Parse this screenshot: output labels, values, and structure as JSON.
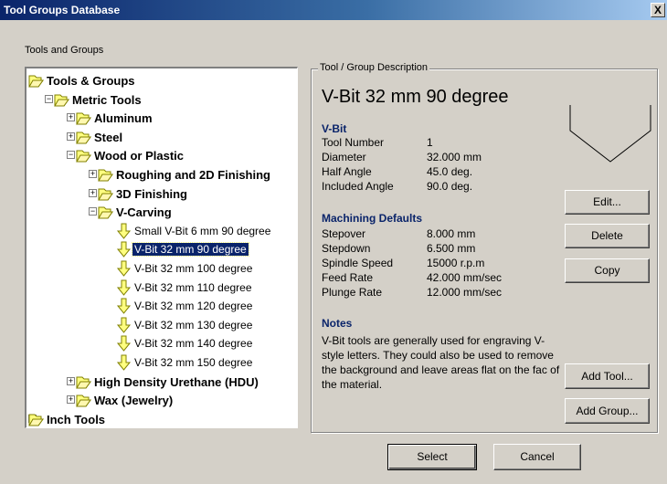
{
  "window": {
    "title": "Tool Groups Database",
    "close_label": "X"
  },
  "tree_label": "Tools and Groups",
  "tree": [
    {
      "label": "Tools & Groups",
      "level": 0,
      "toggle": "",
      "bold": true,
      "type": "folder"
    },
    {
      "label": "Metric Tools",
      "level": 1,
      "toggle": "-",
      "bold": true,
      "type": "folder"
    },
    {
      "label": "Aluminum",
      "level": 2,
      "toggle": "+",
      "bold": true,
      "type": "folder"
    },
    {
      "label": "Steel",
      "level": 2,
      "toggle": "+",
      "bold": true,
      "type": "folder"
    },
    {
      "label": "Wood or Plastic",
      "level": 2,
      "toggle": "-",
      "bold": true,
      "type": "folder"
    },
    {
      "label": "Roughing and 2D Finishing",
      "level": 3,
      "toggle": "+",
      "bold": true,
      "type": "folder"
    },
    {
      "label": "3D Finishing",
      "level": 3,
      "toggle": "+",
      "bold": true,
      "type": "folder"
    },
    {
      "label": "V-Carving",
      "level": 3,
      "toggle": "-",
      "bold": true,
      "type": "folder"
    },
    {
      "label": "Small V-Bit 6 mm 90 degree",
      "level": 4,
      "toggle": "",
      "bold": false,
      "type": "tool"
    },
    {
      "label": "V-Bit 32 mm 90 degree",
      "level": 4,
      "toggle": "",
      "bold": false,
      "type": "tool",
      "selected": true
    },
    {
      "label": "V-Bit 32 mm 100 degree",
      "level": 4,
      "toggle": "",
      "bold": false,
      "type": "tool"
    },
    {
      "label": "V-Bit 32 mm 110 degree",
      "level": 4,
      "toggle": "",
      "bold": false,
      "type": "tool"
    },
    {
      "label": "V-Bit 32 mm 120 degree",
      "level": 4,
      "toggle": "",
      "bold": false,
      "type": "tool"
    },
    {
      "label": "V-Bit 32 mm 130 degree",
      "level": 4,
      "toggle": "",
      "bold": false,
      "type": "tool"
    },
    {
      "label": "V-Bit 32 mm 140 degree",
      "level": 4,
      "toggle": "",
      "bold": false,
      "type": "tool"
    },
    {
      "label": "V-Bit 32 mm 150 degree",
      "level": 4,
      "toggle": "",
      "bold": false,
      "type": "tool"
    },
    {
      "label": "High Density Urethane (HDU)",
      "level": 2,
      "toggle": "+",
      "bold": true,
      "type": "folder"
    },
    {
      "label": "Wax (Jewelry)",
      "level": 2,
      "toggle": "+",
      "bold": true,
      "type": "folder"
    },
    {
      "label": "Inch Tools",
      "level": 0,
      "toggle": "+",
      "bold": true,
      "type": "folder"
    }
  ],
  "description": {
    "legend": "Tool / Group Description",
    "title": "V-Bit 32 mm 90 degree",
    "tool_heading": "V-Bit",
    "tool_fields": [
      {
        "label": "Tool Number",
        "value": "1"
      },
      {
        "label": "Diameter",
        "value": "32.000 mm"
      },
      {
        "label": "Half Angle",
        "value": "45.0 deg."
      },
      {
        "label": "Included Angle",
        "value": "90.0 deg."
      }
    ],
    "machining_heading": "Machining Defaults",
    "machining_fields": [
      {
        "label": "Stepover",
        "value": "8.000 mm"
      },
      {
        "label": "Stepdown",
        "value": "6.500 mm"
      },
      {
        "label": "Spindle Speed",
        "value": "15000 r.p.m"
      },
      {
        "label": "Feed Rate",
        "value": "42.000 mm/sec"
      },
      {
        "label": "Plunge Rate",
        "value": "12.000 mm/sec"
      }
    ],
    "notes_heading": "Notes",
    "notes_text": "V-Bit tools are generally used for engraving V-style letters. They could also be used to remove the background and leave areas flat on the fac of the material."
  },
  "buttons": {
    "edit": "Edit...",
    "delete": "Delete",
    "copy": "Copy",
    "add_tool": "Add Tool...",
    "add_group": "Add Group...",
    "select": "Select",
    "cancel": "Cancel"
  },
  "colors": {
    "title_start": "#0a246a",
    "title_end": "#a6caf0",
    "heading": "#0a246a",
    "selection": "#0a246a"
  }
}
